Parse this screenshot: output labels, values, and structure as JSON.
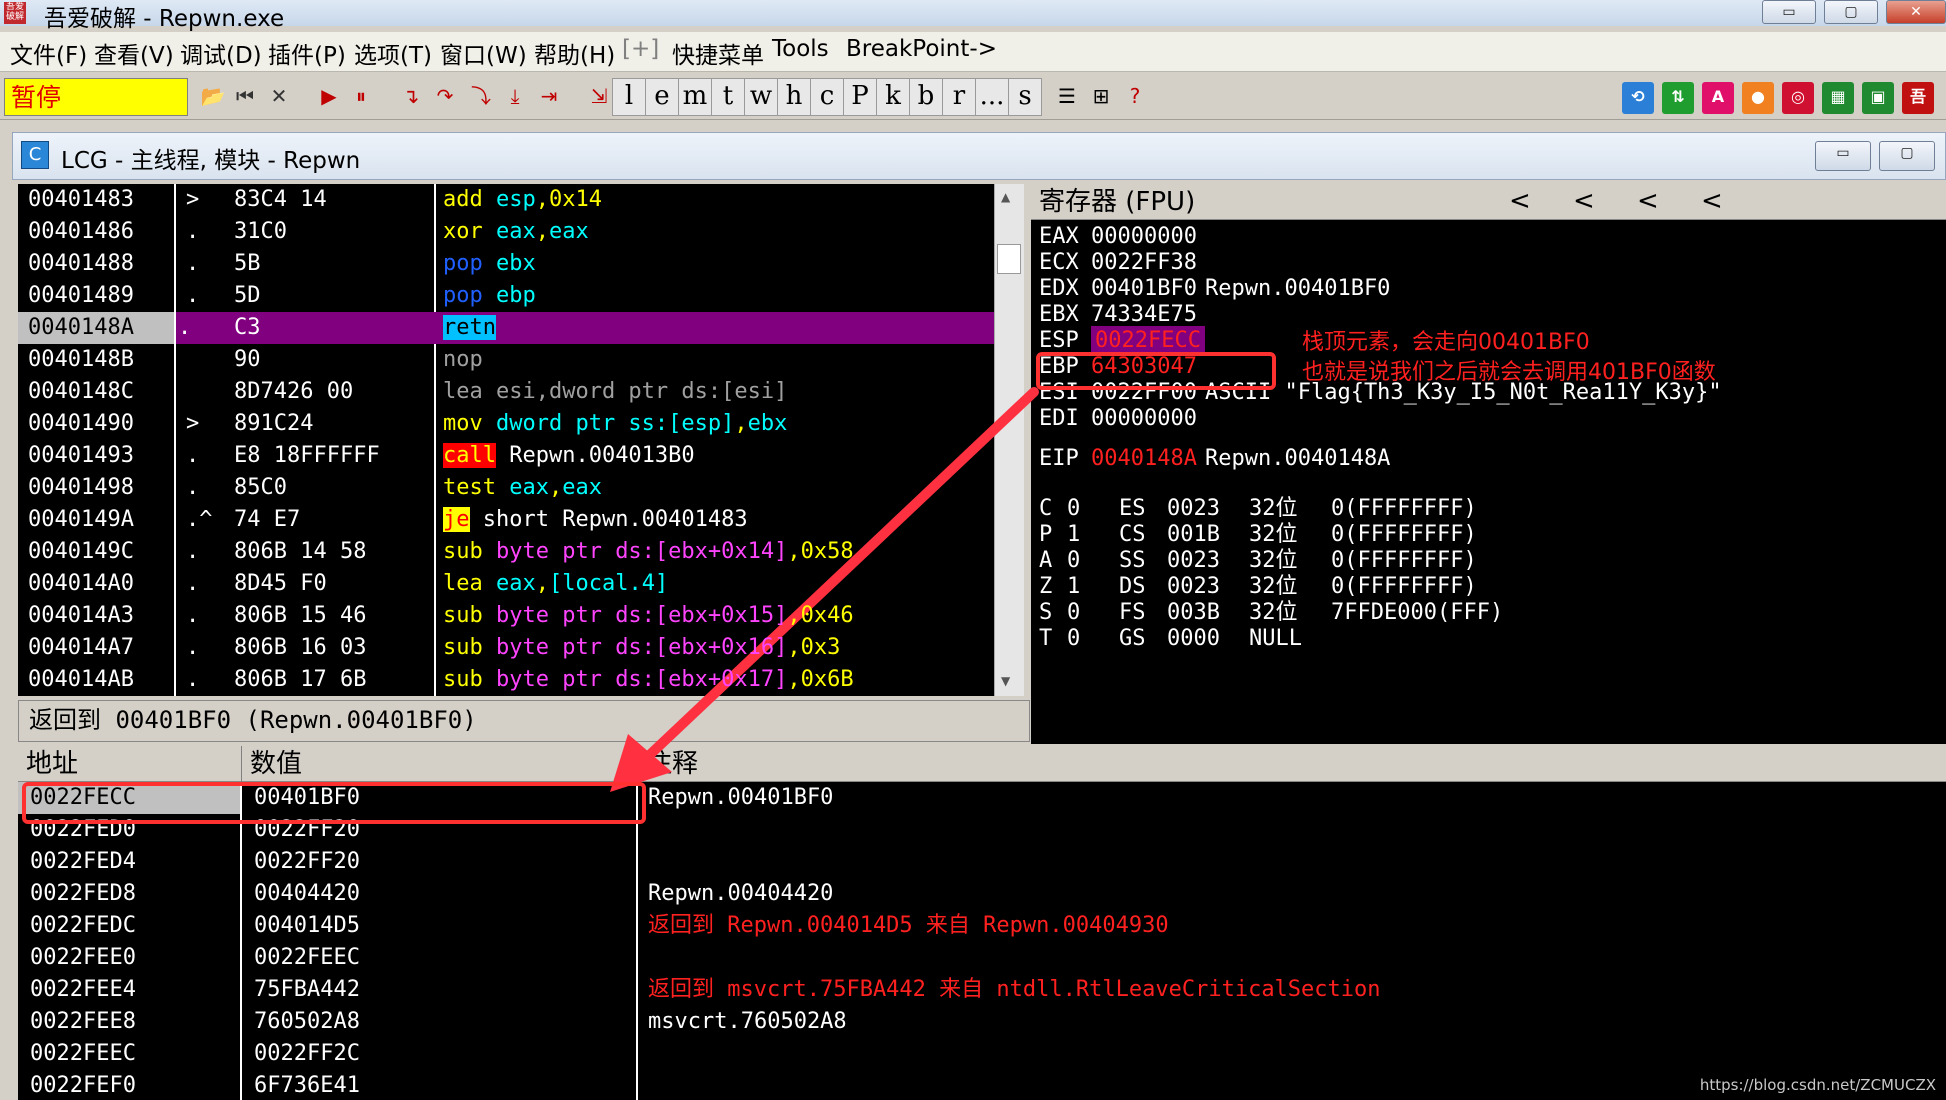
{
  "window": {
    "title": "吾爱破解 - Repwn.exe",
    "icon_text": "吾爱破解",
    "controls": {
      "minimize": "▭",
      "maximize": "▢",
      "close": "✕"
    }
  },
  "menu": {
    "items": [
      "文件(F)",
      "查看(V)",
      "调试(D)",
      "插件(P)",
      "选项(T)",
      "窗口(W)",
      "帮助(H)",
      "[+]",
      "快捷菜单",
      "Tools",
      "BreakPoint->"
    ]
  },
  "toolbar": {
    "status": "暂停",
    "buttons": [
      "open-icon",
      "restart-icon",
      "close-icon",
      "run-icon",
      "pause-icon",
      "step-into-icon",
      "step-over-icon",
      "trace-into-icon",
      "trace-over-icon",
      "execute-till-return-icon",
      "go-to-icon"
    ],
    "letters": [
      "l",
      "e",
      "m",
      "t",
      "w",
      "h",
      "c",
      "P",
      "k",
      "b",
      "r",
      "...",
      "s"
    ],
    "right_icons": [
      {
        "name": "refresh-icon",
        "color": "#2b7fd6",
        "glyph": "⟲"
      },
      {
        "name": "arrows-icon",
        "color": "#1f9e2f",
        "glyph": "⇅"
      },
      {
        "name": "a-icon",
        "color": "#e0106a",
        "glyph": "A"
      },
      {
        "name": "record-icon",
        "color": "#f08020",
        "glyph": "●"
      },
      {
        "name": "target-icon",
        "color": "#d01030",
        "glyph": "◎"
      },
      {
        "name": "chip-icon",
        "color": "#208a30",
        "glyph": "▦"
      },
      {
        "name": "monitor-icon",
        "color": "#208a30",
        "glyph": "▣"
      },
      {
        "name": "calc-icon",
        "color": "#c01010",
        "glyph": "吾"
      }
    ]
  },
  "mdi": {
    "icon": "C",
    "title": "LCG - 主线程, 模块 - Repwn"
  },
  "disasm": {
    "rows": [
      {
        "addr": "00401483",
        "mark": ">",
        "hex": "83C4 14",
        "parts": [
          [
            "add ",
            "k-yel"
          ],
          [
            "esp",
            "k-cy"
          ],
          [
            ",",
            "k-yel"
          ],
          [
            "0x14",
            "k-yel"
          ]
        ]
      },
      {
        "addr": "00401486",
        "mark": ".",
        "hex": "31C0",
        "parts": [
          [
            "xor ",
            "k-yel"
          ],
          [
            "eax",
            "k-cy"
          ],
          [
            ",",
            "k-yel"
          ],
          [
            "eax",
            "k-cy"
          ]
        ]
      },
      {
        "addr": "00401488",
        "mark": ".",
        "hex": "5B",
        "parts": [
          [
            "pop ",
            "k-blue"
          ],
          [
            "ebx",
            "k-cy"
          ]
        ]
      },
      {
        "addr": "00401489",
        "mark": ".",
        "hex": "5D",
        "parts": [
          [
            "pop ",
            "k-blue"
          ],
          [
            "ebp",
            "k-cy"
          ]
        ]
      },
      {
        "addr": "0040148A",
        "mark": ".",
        "hex": "C3",
        "selected": true,
        "parts": [
          [
            "retn",
            "retn"
          ]
        ]
      },
      {
        "addr": "0040148B",
        "mark": "",
        "hex": "90",
        "parts": [
          [
            "nop",
            "k-gray"
          ]
        ]
      },
      {
        "addr": "0040148C",
        "mark": "",
        "hex": "8D7426 00",
        "parts": [
          [
            "lea esi,dword ptr ds:[esi]",
            "k-gray"
          ]
        ]
      },
      {
        "addr": "00401490",
        "mark": ">",
        "hex": "891C24",
        "parts": [
          [
            "mov ",
            "k-yel"
          ],
          [
            "dword ptr ss:[esp]",
            "k-cy"
          ],
          [
            ",",
            "k-yel"
          ],
          [
            "ebx",
            "k-cy"
          ]
        ]
      },
      {
        "addr": "00401493",
        "mark": ".",
        "hex": "E8 18FFFFFF",
        "parts": [
          [
            "call",
            "call"
          ],
          [
            " Repwn.004013B0",
            ""
          ]
        ]
      },
      {
        "addr": "00401498",
        "mark": ".",
        "hex": "85C0",
        "parts": [
          [
            "test ",
            "k-yel"
          ],
          [
            "eax",
            "k-cy"
          ],
          [
            ",",
            "k-yel"
          ],
          [
            "eax",
            "k-cy"
          ]
        ]
      },
      {
        "addr": "0040149A",
        "mark": ".^",
        "hex": "74 E7",
        "parts": [
          [
            "je",
            "je"
          ],
          [
            " short Repwn.00401483",
            ""
          ]
        ]
      },
      {
        "addr": "0040149C",
        "mark": ".",
        "hex": "806B 14 58",
        "parts": [
          [
            "sub ",
            "k-yel"
          ],
          [
            "byte ptr ds:[ebx+0x14]",
            "k-mag"
          ],
          [
            ",",
            "k-yel"
          ],
          [
            "0x58",
            "k-yel"
          ]
        ]
      },
      {
        "addr": "004014A0",
        "mark": ".",
        "hex": "8D45 F0",
        "parts": [
          [
            "lea ",
            "k-yel"
          ],
          [
            "eax",
            "k-cy"
          ],
          [
            ",",
            "k-yel"
          ],
          [
            "[local.4]",
            "k-cy"
          ]
        ]
      },
      {
        "addr": "004014A3",
        "mark": ".",
        "hex": "806B 15 46",
        "parts": [
          [
            "sub ",
            "k-yel"
          ],
          [
            "byte ptr ds:[ebx+0x15]",
            "k-mag"
          ],
          [
            ",",
            "k-yel"
          ],
          [
            "0x46",
            "k-yel"
          ]
        ]
      },
      {
        "addr": "004014A7",
        "mark": ".",
        "hex": "806B 16 03",
        "parts": [
          [
            "sub ",
            "k-yel"
          ],
          [
            "byte ptr ds:[ebx+0x16]",
            "k-mag"
          ],
          [
            ",",
            "k-yel"
          ],
          [
            "0x3",
            "k-yel"
          ]
        ]
      },
      {
        "addr": "004014AB",
        "mark": ".",
        "hex": "806B 17 6B",
        "parts": [
          [
            "sub ",
            "k-yel"
          ],
          [
            "byte ptr ds:[ebx+0x17]",
            "k-mag"
          ],
          [
            ",",
            "k-yel"
          ],
          [
            "0x6B",
            "k-yel"
          ]
        ]
      }
    ]
  },
  "info_bar": "返回到 00401BF0 (Repwn.00401BF0)",
  "registers": {
    "header": "寄存器 (FPU)",
    "nav_arrows": [
      "<",
      "<",
      "<",
      "<"
    ],
    "rows": [
      {
        "name": "EAX",
        "value": "00000000",
        "comment": "",
        "red": false
      },
      {
        "name": "ECX",
        "value": "0022FF38",
        "comment": "",
        "red": false
      },
      {
        "name": "EDX",
        "value": "00401BF0",
        "comment": "Repwn.00401BF0",
        "red": false
      },
      {
        "name": "EBX",
        "value": "74334E75",
        "comment": "",
        "red": false
      },
      {
        "name": "ESP",
        "value": "0022FECC",
        "comment": "",
        "red": true,
        "highlight": true
      },
      {
        "name": "EBP",
        "value": "64303047",
        "comment": "",
        "red": true
      },
      {
        "name": "ESI",
        "value": "0022FF00",
        "comment": "ASCII \"Flag{Th3_K3y_I5_N0t_Rea11Y_K3y}\"",
        "red": false
      },
      {
        "name": "EDI",
        "value": "00000000",
        "comment": "",
        "red": false
      }
    ],
    "eip": {
      "name": "EIP",
      "value": "0040148A",
      "comment": "Repwn.0040148A"
    },
    "flags": [
      {
        "flag": "C",
        "val": "0",
        "seg": "ES",
        "sel": "0023",
        "bits": "32位",
        "base": "0(FFFFFFFF)"
      },
      {
        "flag": "P",
        "val": "1",
        "seg": "CS",
        "sel": "001B",
        "bits": "32位",
        "base": "0(FFFFFFFF)"
      },
      {
        "flag": "A",
        "val": "0",
        "seg": "SS",
        "sel": "0023",
        "bits": "32位",
        "base": "0(FFFFFFFF)"
      },
      {
        "flag": "Z",
        "val": "1",
        "seg": "DS",
        "sel": "0023",
        "bits": "32位",
        "base": "0(FFFFFFFF)"
      },
      {
        "flag": "S",
        "val": "0",
        "seg": "FS",
        "sel": "003B",
        "bits": "32位",
        "base": "7FFDE000(FFF)"
      },
      {
        "flag": "T",
        "val": "0",
        "seg": "GS",
        "sel": "0000",
        "bits": "NULL",
        "base": ""
      }
    ],
    "annotation": [
      "栈顶元素，会走向00401BF0",
      "也就是说我们之后就会去调用401BF0函数"
    ]
  },
  "stack": {
    "headers": [
      "地址",
      "数值",
      "注释"
    ],
    "rows": [
      {
        "addr": "0022FECC",
        "value": "00401BF0",
        "comment": "Repwn.00401BF0",
        "red": false,
        "selected": true
      },
      {
        "addr": "0022FED0",
        "value": "0022FF20",
        "comment": "",
        "red": false
      },
      {
        "addr": "0022FED4",
        "value": "0022FF20",
        "comment": "",
        "red": false
      },
      {
        "addr": "0022FED8",
        "value": "00404420",
        "comment": "Repwn.00404420",
        "red": false
      },
      {
        "addr": "0022FEDC",
        "value": "004014D5",
        "comment": "返回到 Repwn.004014D5 来自 Repwn.00404930",
        "red": true
      },
      {
        "addr": "0022FEE0",
        "value": "0022FEEC",
        "comment": "",
        "red": false
      },
      {
        "addr": "0022FEE4",
        "value": "75FBA442",
        "comment": "返回到 msvcrt.75FBA442 来自 ntdll.RtlLeaveCriticalSection",
        "red": true
      },
      {
        "addr": "0022FEE8",
        "value": "760502A8",
        "comment": "msvcrt.760502A8",
        "red": false
      },
      {
        "addr": "0022FEEC",
        "value": "0022FF2C",
        "comment": "",
        "red": false
      },
      {
        "addr": "0022FEF0",
        "value": "6F736E41",
        "comment": "",
        "red": false
      }
    ]
  },
  "watermark": "https://blog.csdn.net/ZCMUCZX",
  "colors": {
    "accent_red": "#ff3030",
    "selection": "#800080",
    "status_bg": "#ffff00"
  }
}
